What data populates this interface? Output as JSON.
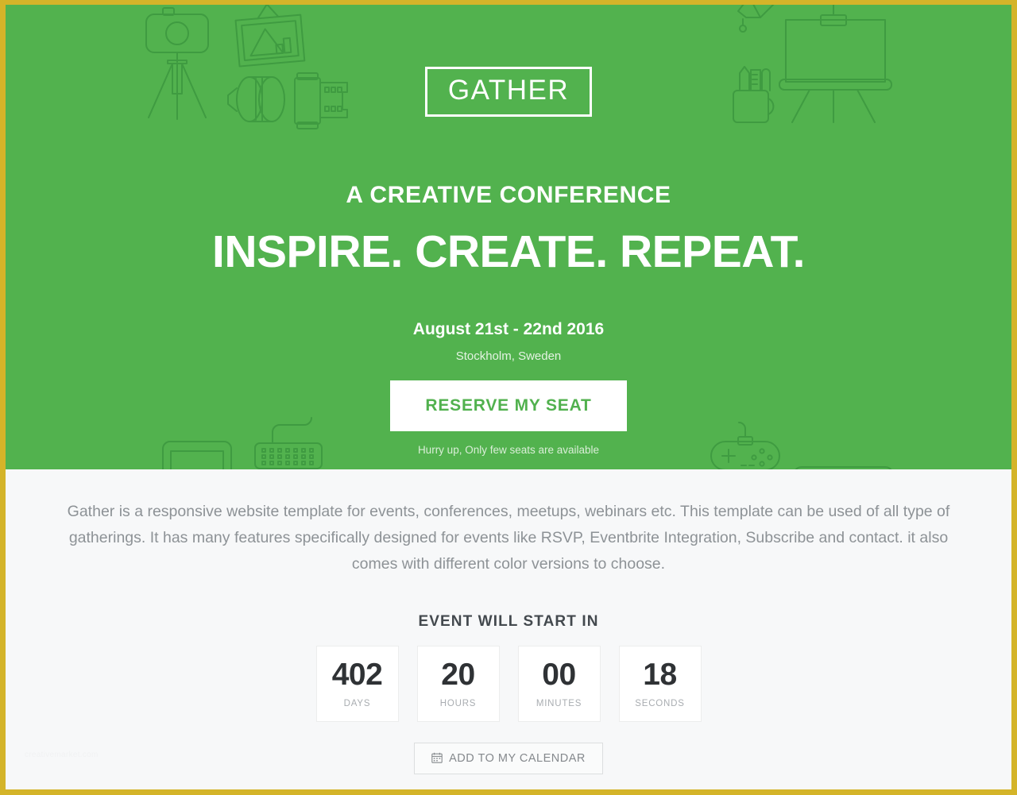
{
  "theme": {
    "page_border_color": "#d4b429",
    "hero_background": "#52b24e",
    "hero_art_stroke": "#3f9b41",
    "content_background": "#f7f8f9",
    "accent_green": "#51b14e",
    "heading_color": "#43494e",
    "muted_text": "#8d9296"
  },
  "hero": {
    "logo": "GATHER",
    "tagline": "A CREATIVE CONFERENCE",
    "headline": "INSPIRE. CREATE. REPEAT.",
    "event_date": "August 21st - 22nd 2016",
    "event_location": "Stockholm, Sweden",
    "cta_label": "RESERVE MY SEAT",
    "cta_note": "Hurry up, Only few seats are available",
    "art_icons": [
      "camera-tripod-icon",
      "framed-picture-icon",
      "camera-lens-icon",
      "film-roll-icon",
      "presentation-easel-icon",
      "pencil-cup-icon",
      "paintbrush-icon",
      "tablet-icon",
      "keyboard-icon",
      "gamepad-icon",
      "device-icon"
    ]
  },
  "content": {
    "intro": "Gather is a responsive website template for events, conferences, meetups, webinars etc. This template can be used of all type of gatherings. It has many features specifically designed for events like RSVP, Eventbrite Integration, Subscribe and contact. it also comes with different color versions to choose.",
    "countdown_title": "EVENT WILL START IN",
    "countdown": [
      {
        "value": "402",
        "label": "DAYS"
      },
      {
        "value": "20",
        "label": "HOURS"
      },
      {
        "value": "00",
        "label": "MINUTES"
      },
      {
        "value": "18",
        "label": "SECONDS"
      }
    ],
    "calendar_button": {
      "icon": "calendar-icon",
      "glyph": "🗓",
      "label": "ADD TO MY CALENDAR"
    },
    "watermark": "creativemarket.com"
  }
}
